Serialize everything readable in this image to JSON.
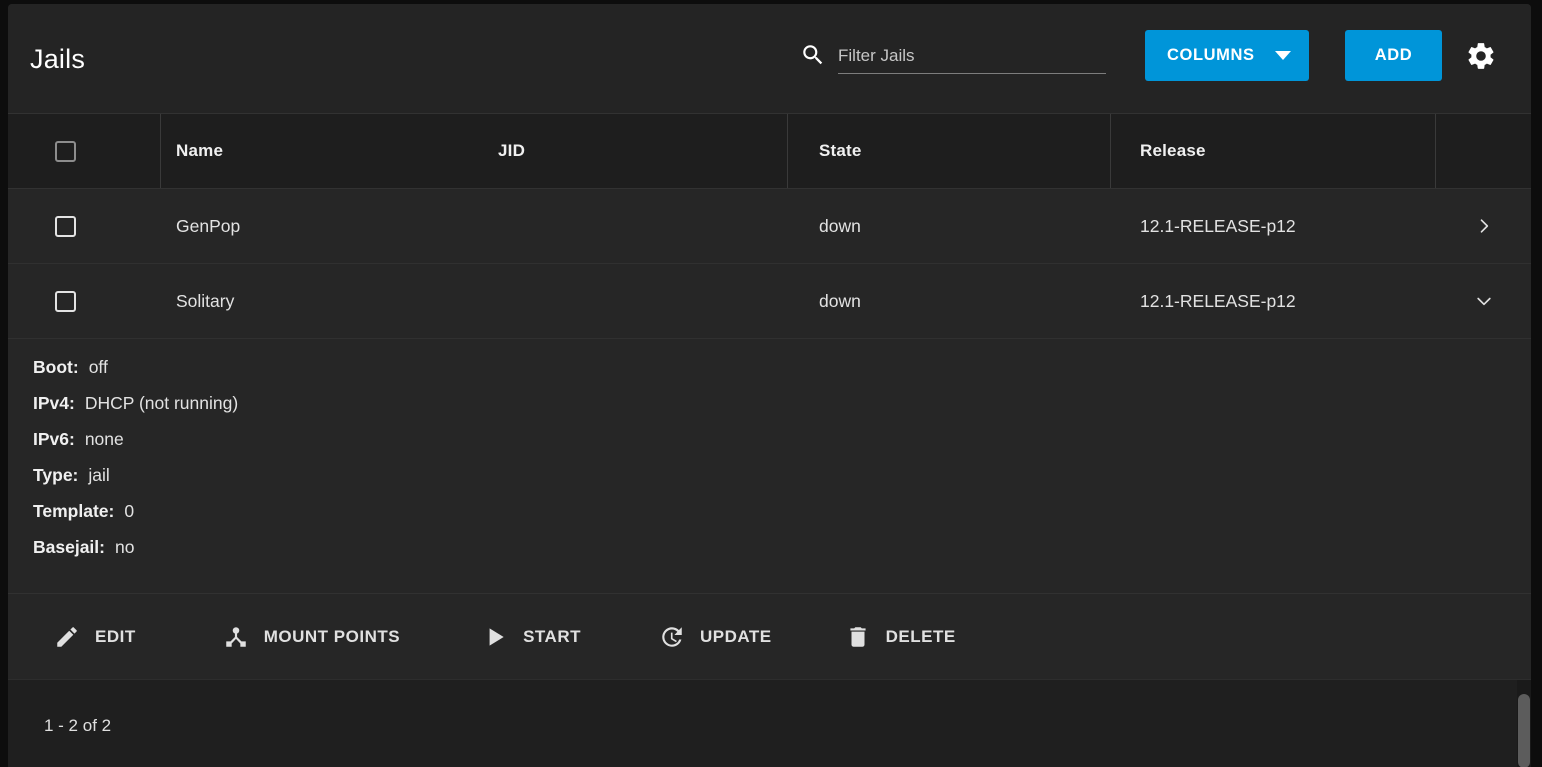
{
  "header": {
    "title": "Jails",
    "search": {
      "placeholder": "Filter Jails",
      "value": "",
      "icon": "search-icon"
    },
    "columns_button": {
      "label": "COLUMNS",
      "icon": "chevron-down-icon"
    },
    "add_button": {
      "label": "ADD"
    },
    "settings_button": {
      "icon": "gear-icon"
    },
    "accent_color": "#0095d9"
  },
  "table": {
    "columns": [
      "Name",
      "JID",
      "State",
      "Release"
    ],
    "select_all_checkbox": {
      "checked": false
    },
    "rows": [
      {
        "checked": false,
        "name": "GenPop",
        "jid": "",
        "state": "down",
        "release": "12.1-RELEASE-p12",
        "expanded": false,
        "expand_icon": "chevron-right-icon"
      },
      {
        "checked": false,
        "name": "Solitary",
        "jid": "",
        "state": "down",
        "release": "12.1-RELEASE-p12",
        "expanded": true,
        "expand_icon": "chevron-down-icon"
      }
    ]
  },
  "detail": {
    "fields": [
      {
        "key": "Boot:",
        "value": "off"
      },
      {
        "key": "IPv4:",
        "value": "DHCP (not running)"
      },
      {
        "key": "IPv6:",
        "value": "none"
      },
      {
        "key": "Type:",
        "value": "jail"
      },
      {
        "key": "Template:",
        "value": "0"
      },
      {
        "key": "Basejail:",
        "value": "no"
      }
    ],
    "actions": [
      {
        "label": "EDIT",
        "icon": "pencil-icon"
      },
      {
        "label": "MOUNT POINTS",
        "icon": "device-hub-icon"
      },
      {
        "label": "START",
        "icon": "play-icon"
      },
      {
        "label": "UPDATE",
        "icon": "update-icon"
      },
      {
        "label": "DELETE",
        "icon": "trash-icon"
      }
    ]
  },
  "footer": {
    "range_text": "1 - 2 of 2"
  }
}
